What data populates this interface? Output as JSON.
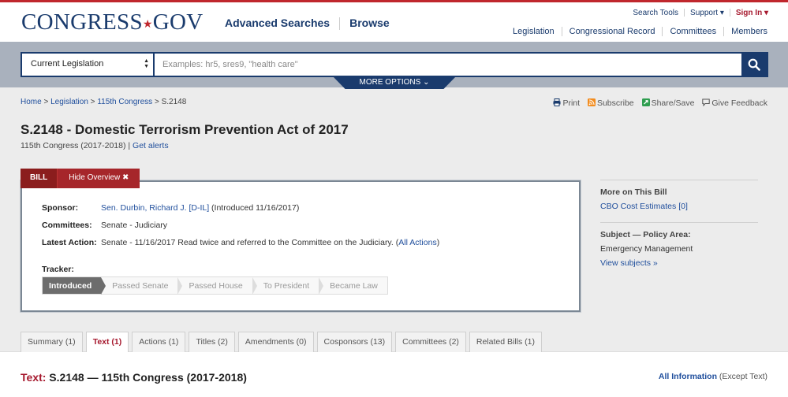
{
  "header": {
    "logo_main": "CONGRESS",
    "logo_star": "★",
    "logo_suffix": "GOV",
    "nav_advanced": "Advanced Searches",
    "nav_browse": "Browse",
    "util_search_tools": "Search Tools",
    "util_support": "Support ▾",
    "util_signin": "Sign In ▾",
    "sec_legislation": "Legislation",
    "sec_congressional_record": "Congressional Record",
    "sec_committees": "Committees",
    "sec_members": "Members"
  },
  "search": {
    "scope_value": "Current Legislation",
    "placeholder": "Examples: hr5, sres9, \"health care\"",
    "more_options": "MORE OPTIONS ⌄"
  },
  "breadcrumb": {
    "home": "Home",
    "sep": " > ",
    "legislation": "Legislation",
    "congress": "115th Congress",
    "current": "S.2148"
  },
  "actions": {
    "print": "Print",
    "subscribe": "Subscribe",
    "share": "Share/Save",
    "feedback": "Give Feedback"
  },
  "bill": {
    "title": "S.2148 - Domestic Terrorism Prevention Act of 2017",
    "congress_text": "115th Congress (2017-2018) | ",
    "get_alerts": "Get alerts",
    "tab_label": "BILL",
    "hide_overview": "Hide Overview ✖",
    "sponsor_label": "Sponsor:",
    "sponsor_name": "Sen. Durbin, Richard J. [D-IL]",
    "sponsor_intro": " (Introduced 11/16/2017)",
    "committees_label": "Committees:",
    "committees_value": "Senate - Judiciary",
    "latest_label": "Latest Action:",
    "latest_value": "Senate - 11/16/2017 Read twice and referred to the Committee on the Judiciary.  (",
    "all_actions": "All Actions",
    "latest_close": ")",
    "tracker_label": "Tracker:",
    "tracker_steps": [
      "Introduced",
      "Passed Senate",
      "Passed House",
      "To President",
      "Became Law"
    ]
  },
  "sidebar": {
    "more_title": "More on This Bill",
    "cbo_link": "CBO Cost Estimates [0]",
    "subject_title": "Subject — Policy Area:",
    "subject_value": "Emergency Management",
    "view_subjects": "View subjects »"
  },
  "tabs": [
    "Summary (1)",
    "Text (1)",
    "Actions (1)",
    "Titles (2)",
    "Amendments (0)",
    "Cosponsors (13)",
    "Committees (2)",
    "Related Bills (1)"
  ],
  "text_section": {
    "label": "Text:",
    "title": " S.2148 — 115th Congress (2017-2018)",
    "all_info": "All Information",
    "except_text": " (Except Text)"
  },
  "colors": {
    "brand_navy": "#1a3b6d",
    "brand_red": "#a6192e",
    "band_gray": "#a9b1bd"
  }
}
